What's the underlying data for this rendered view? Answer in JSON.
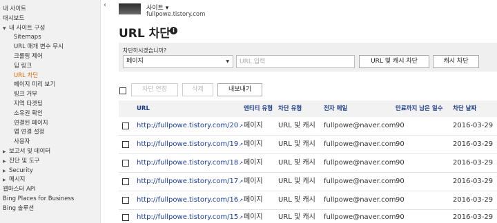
{
  "sidebar": {
    "items": [
      {
        "label": "내 사이트",
        "indent": false,
        "arrow": "",
        "active": false
      },
      {
        "label": "대시보드",
        "indent": false,
        "arrow": "",
        "active": false
      },
      {
        "label": "내 사이트 구성",
        "indent": false,
        "arrow": "▼",
        "active": false
      },
      {
        "label": "Sitemaps",
        "indent": true,
        "arrow": "",
        "active": false
      },
      {
        "label": "URL 매개 변수 무시",
        "indent": true,
        "arrow": "",
        "active": false
      },
      {
        "label": "크롤링 제어",
        "indent": true,
        "arrow": "",
        "active": false
      },
      {
        "label": "딥 링크",
        "indent": true,
        "arrow": "",
        "active": false
      },
      {
        "label": "URL 차단",
        "indent": true,
        "arrow": "",
        "active": true
      },
      {
        "label": "페이지 미리 보기",
        "indent": true,
        "arrow": "",
        "active": false
      },
      {
        "label": "링크 거부",
        "indent": true,
        "arrow": "",
        "active": false
      },
      {
        "label": "지역 타겟팅",
        "indent": true,
        "arrow": "",
        "active": false
      },
      {
        "label": "소유권 확인",
        "indent": true,
        "arrow": "",
        "active": false
      },
      {
        "label": "연결된 페이지",
        "indent": true,
        "arrow": "",
        "active": false
      },
      {
        "label": "앱 연결 설정",
        "indent": true,
        "arrow": "",
        "active": false
      },
      {
        "label": "사용자",
        "indent": true,
        "arrow": "",
        "active": false
      },
      {
        "label": "보고서 및 데이터",
        "indent": false,
        "arrow": "▶",
        "active": false
      },
      {
        "label": "진단 및 도구",
        "indent": false,
        "arrow": "▶",
        "active": false
      },
      {
        "label": "Security",
        "indent": false,
        "arrow": "▶",
        "active": false
      },
      {
        "label": "메시지",
        "indent": false,
        "arrow": "▶",
        "active": false
      },
      {
        "label": "웹마스터 API",
        "indent": false,
        "arrow": "",
        "active": false
      },
      {
        "label": "Bing Places for Business",
        "indent": false,
        "arrow": "",
        "active": false
      },
      {
        "label": "Bing 솔루션",
        "indent": false,
        "arrow": "",
        "active": false
      }
    ],
    "collapse_icon": "‹",
    "active_color": "#e46c0a"
  },
  "header": {
    "site_label": "사이트 ▾",
    "site_url": "fullpowe.tistory.com",
    "page_title": "URL 차단",
    "info_icon": "i"
  },
  "block_panel": {
    "question": "차단하시겠습니까?",
    "type_selected": "페이지",
    "url_placeholder": "URL 입력",
    "btn_url_cache": "URL 및 캐시 차단",
    "btn_cache": "캐시 차단"
  },
  "toolbar": {
    "extend_label": "차단 연장",
    "delete_label": "삭제",
    "export_label": "내보내기"
  },
  "table": {
    "headers": [
      "URL",
      "엔티티 유형",
      "차단 유형",
      "전자 메일",
      "만료까지 남은 일수",
      "차단 날짜"
    ],
    "rows": [
      {
        "url": "http://fullpowe.tistory.com/20",
        "entity": "페이지",
        "block": "URL 및 캐시",
        "email": "fullpowe@naver.com",
        "days": "90",
        "date": "2016-03-29"
      },
      {
        "url": "http://fullpowe.tistory.com/19",
        "entity": "페이지",
        "block": "URL 및 캐시",
        "email": "fullpowe@naver.com",
        "days": "90",
        "date": "2016-03-29"
      },
      {
        "url": "http://fullpowe.tistory.com/18",
        "entity": "페이지",
        "block": "URL 및 캐시",
        "email": "fullpowe@naver.com",
        "days": "90",
        "date": "2016-03-29"
      },
      {
        "url": "http://fullpowe.tistory.com/17",
        "entity": "페이지",
        "block": "URL 및 캐시",
        "email": "fullpowe@naver.com",
        "days": "90",
        "date": "2016-03-29"
      },
      {
        "url": "http://fullpowe.tistory.com/16",
        "entity": "페이지",
        "block": "URL 및 캐시",
        "email": "fullpowe@naver.com",
        "days": "90",
        "date": "2016-03-29"
      },
      {
        "url": "http://fullpowe.tistory.com/15",
        "entity": "페이지",
        "block": "URL 및 캐시",
        "email": "fullpowe@naver.com",
        "days": "90",
        "date": "2016-03-29"
      }
    ],
    "link_color": "#1a3c9c",
    "header_color": "#1a3c8c"
  }
}
